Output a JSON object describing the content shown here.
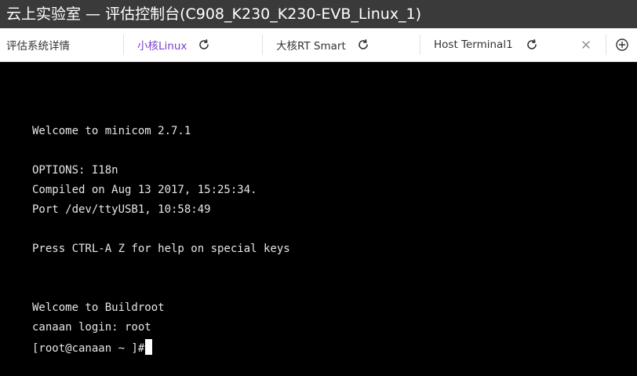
{
  "window": {
    "title": "云上实验室 — 评估控制台(C908_K230_K230-EVB_Linux_1)"
  },
  "tabs": [
    {
      "label": "评估系统详情",
      "active": false,
      "icon": "none"
    },
    {
      "label": "小核Linux",
      "active": true,
      "icon": "refresh-icon"
    },
    {
      "label": "大核RT Smart",
      "active": false,
      "icon": "refresh-icon"
    },
    {
      "label": "Host Terminal1",
      "active": false,
      "icon": "refresh-icon"
    }
  ],
  "tab_actions": {
    "close_icon": "close-icon",
    "add_icon": "add-tab-icon"
  },
  "terminal": {
    "lines": [
      "Welcome to minicom 2.7.1",
      "OPTIONS: I18n",
      "Compiled on Aug 13 2017, 15:25:34.",
      "Port /dev/ttyUSB1, 10:58:49",
      "Press CTRL-A Z for help on special keys",
      "Welcome to Buildroot",
      "canaan login: root",
      "[root@canaan ~ ]#"
    ]
  },
  "colors": {
    "titlebar_bg": "#3a3a3a",
    "tabbar_bg": "#ffffff",
    "active_tab_text": "#7b3fd0",
    "terminal_bg": "#000000",
    "terminal_text": "#e6e6e6"
  }
}
